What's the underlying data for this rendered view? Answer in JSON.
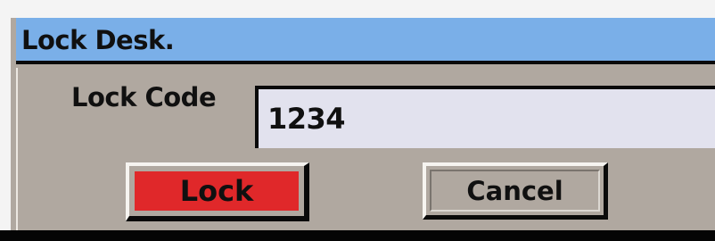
{
  "window": {
    "title": "Lock Desk."
  },
  "form": {
    "lock_code_label": "Lock Code",
    "lock_code_value": "1234"
  },
  "buttons": {
    "lock_label": "Lock",
    "cancel_label": "Cancel"
  },
  "colors": {
    "titlebar": "#7aafe8",
    "dialog_bg": "#b0a8a0",
    "lock_button": "#e0282a",
    "input_bg": "#e2e2ee"
  }
}
